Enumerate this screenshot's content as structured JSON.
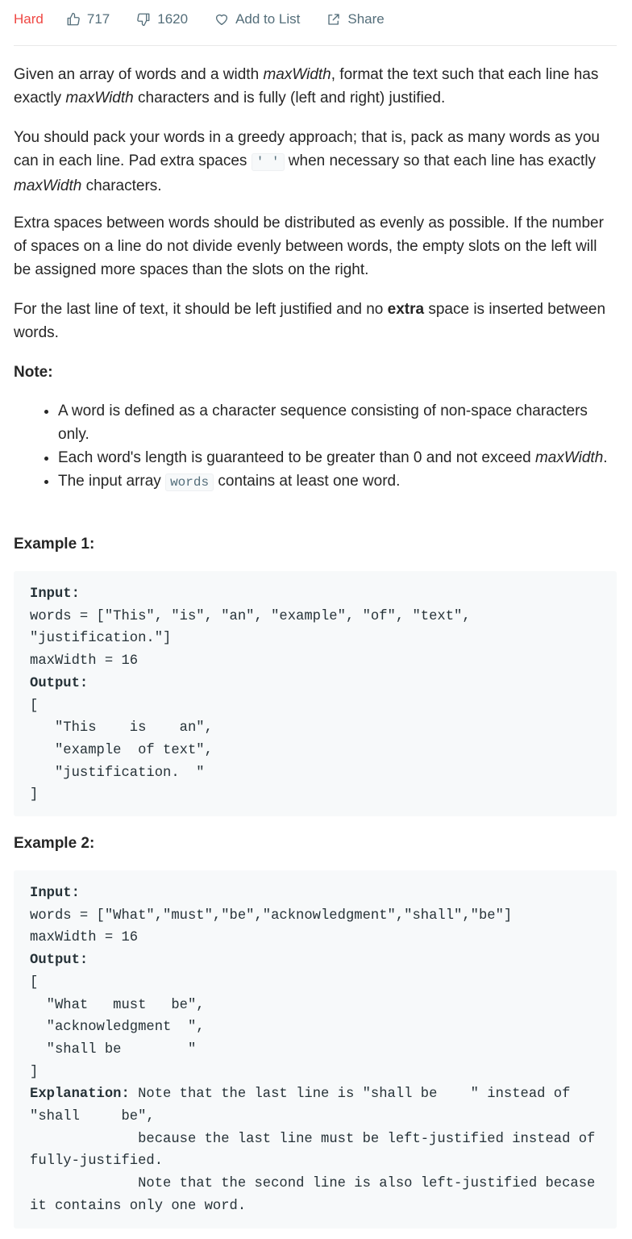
{
  "toolbar": {
    "difficulty": "Hard",
    "likes": "717",
    "dislikes": "1620",
    "add_to_list": "Add to List",
    "share": "Share"
  },
  "description": {
    "p1_a": "Given an array of words and a width ",
    "p1_var1": "maxWidth",
    "p1_b": ", format the text such that each line has exactly ",
    "p1_var2": "maxWidth",
    "p1_c": " characters and is fully (left and right) justified.",
    "p2_a": "You should pack your words in a greedy approach; that is, pack as many words as you can in each line. Pad extra spaces ",
    "p2_code": "' '",
    "p2_b": " when necessary so that each line has exactly ",
    "p2_var": "maxWidth",
    "p2_c": " characters.",
    "p3": "Extra spaces between words should be distributed as evenly as possible. If the number of spaces on a line do not divide evenly between words, the empty slots on the left will be assigned more spaces than the slots on the right.",
    "p4_a": "For the last line of text, it should be left justified and no ",
    "p4_bold": "extra",
    "p4_b": " space is inserted between words."
  },
  "note": {
    "title": "Note:",
    "item1": "A word is defined as a character sequence consisting of non-space characters only.",
    "item2_a": "Each word's length is guaranteed to be greater than 0 and not exceed ",
    "item2_var": "maxWidth",
    "item2_b": ".",
    "item3_a": "The input array ",
    "item3_code": "words",
    "item3_b": " contains at least one word."
  },
  "example1": {
    "title": "Example 1:",
    "input_label": "Input:",
    "input_text": "\nwords = [\"This\", \"is\", \"an\", \"example\", \"of\", \"text\", \"justification.\"]\nmaxWidth = 16\n",
    "output_label": "Output:",
    "output_text": "\n[\n   \"This    is    an\",\n   \"example  of text\",\n   \"justification.  \"\n]"
  },
  "example2": {
    "title": "Example 2:",
    "input_label": "Input:",
    "input_text": "\nwords = [\"What\",\"must\",\"be\",\"acknowledgment\",\"shall\",\"be\"]\nmaxWidth = 16\n",
    "output_label": "Output:",
    "output_text": "\n[\n  \"What   must   be\",\n  \"acknowledgment  \",\n  \"shall be        \"\n]\n",
    "explanation_label": "Explanation:",
    "explanation_text": " Note that the last line is \"shall be    \" instead of \"shall     be\",\n             because the last line must be left-justified instead of fully-justified.\n             Note that the second line is also left-justified becase it contains only one word."
  }
}
